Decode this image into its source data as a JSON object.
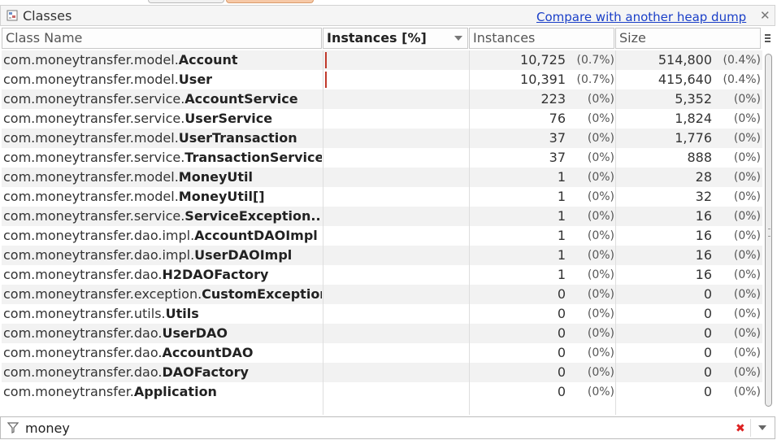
{
  "panel": {
    "title": "Classes",
    "compare_link": "Compare with another heap dump",
    "close_symbol": "✕"
  },
  "columns": {
    "class_name": "Class Name",
    "instances_pct": "Instances [%]",
    "instances": "Instances",
    "size": "Size"
  },
  "rows": [
    {
      "pkg": "com.moneytransfer.model.",
      "cls": "Account",
      "instances": "10,725",
      "instances_pct": "(0.7%)",
      "size": "514,800",
      "size_pct": "(0.4%)",
      "bar_fraction": 0.007
    },
    {
      "pkg": "com.moneytransfer.model.",
      "cls": "User",
      "instances": "10,391",
      "instances_pct": "(0.7%)",
      "size": "415,640",
      "size_pct": "(0.4%)",
      "bar_fraction": 0.007
    },
    {
      "pkg": "com.moneytransfer.service.",
      "cls": "AccountService",
      "instances": "223",
      "instances_pct": "(0%)",
      "size": "5,352",
      "size_pct": "(0%)",
      "bar_fraction": 0
    },
    {
      "pkg": "com.moneytransfer.service.",
      "cls": "UserService",
      "instances": "76",
      "instances_pct": "(0%)",
      "size": "1,824",
      "size_pct": "(0%)",
      "bar_fraction": 0
    },
    {
      "pkg": "com.moneytransfer.model.",
      "cls": "UserTransaction",
      "instances": "37",
      "instances_pct": "(0%)",
      "size": "1,776",
      "size_pct": "(0%)",
      "bar_fraction": 0
    },
    {
      "pkg": "com.moneytransfer.service.",
      "cls": "TransactionService",
      "instances": "37",
      "instances_pct": "(0%)",
      "size": "888",
      "size_pct": "(0%)",
      "bar_fraction": 0
    },
    {
      "pkg": "com.moneytransfer.model.",
      "cls": "MoneyUtil",
      "instances": "1",
      "instances_pct": "(0%)",
      "size": "28",
      "size_pct": "(0%)",
      "bar_fraction": 0
    },
    {
      "pkg": "com.moneytransfer.model.",
      "cls": "MoneyUtil[]",
      "instances": "1",
      "instances_pct": "(0%)",
      "size": "32",
      "size_pct": "(0%)",
      "bar_fraction": 0
    },
    {
      "pkg": "com.moneytransfer.service.",
      "cls": "ServiceException...",
      "instances": "1",
      "instances_pct": "(0%)",
      "size": "16",
      "size_pct": "(0%)",
      "bar_fraction": 0
    },
    {
      "pkg": "com.moneytransfer.dao.impl.",
      "cls": "AccountDAOImpl",
      "instances": "1",
      "instances_pct": "(0%)",
      "size": "16",
      "size_pct": "(0%)",
      "bar_fraction": 0
    },
    {
      "pkg": "com.moneytransfer.dao.impl.",
      "cls": "UserDAOImpl",
      "instances": "1",
      "instances_pct": "(0%)",
      "size": "16",
      "size_pct": "(0%)",
      "bar_fraction": 0
    },
    {
      "pkg": "com.moneytransfer.dao.",
      "cls": "H2DAOFactory",
      "instances": "1",
      "instances_pct": "(0%)",
      "size": "16",
      "size_pct": "(0%)",
      "bar_fraction": 0
    },
    {
      "pkg": "com.moneytransfer.exception.",
      "cls": "CustomException",
      "instances": "0",
      "instances_pct": "(0%)",
      "size": "0",
      "size_pct": "(0%)",
      "bar_fraction": 0
    },
    {
      "pkg": "com.moneytransfer.utils.",
      "cls": "Utils",
      "instances": "0",
      "instances_pct": "(0%)",
      "size": "0",
      "size_pct": "(0%)",
      "bar_fraction": 0
    },
    {
      "pkg": "com.moneytransfer.dao.",
      "cls": "UserDAO",
      "instances": "0",
      "instances_pct": "(0%)",
      "size": "0",
      "size_pct": "(0%)",
      "bar_fraction": 0
    },
    {
      "pkg": "com.moneytransfer.dao.",
      "cls": "AccountDAO",
      "instances": "0",
      "instances_pct": "(0%)",
      "size": "0",
      "size_pct": "(0%)",
      "bar_fraction": 0
    },
    {
      "pkg": "com.moneytransfer.dao.",
      "cls": "DAOFactory",
      "instances": "0",
      "instances_pct": "(0%)",
      "size": "0",
      "size_pct": "(0%)",
      "bar_fraction": 0
    },
    {
      "pkg": "com.moneytransfer.",
      "cls": "Application",
      "instances": "0",
      "instances_pct": "(0%)",
      "size": "0",
      "size_pct": "(0%)",
      "bar_fraction": 0
    }
  ],
  "filter": {
    "value": "money",
    "clear_symbol": "✖"
  },
  "icons": {
    "panel": "classes-icon",
    "filter": "filter-icon",
    "clear": "clear-filter-icon",
    "dropdown": "filter-dropdown-icon",
    "column_menu": "column-menu-icon",
    "sort": "sort-descending-icon"
  },
  "colors": {
    "link": "#1a3fc8",
    "bar": "#c0392b",
    "row_alt": "#f2f2f2"
  }
}
